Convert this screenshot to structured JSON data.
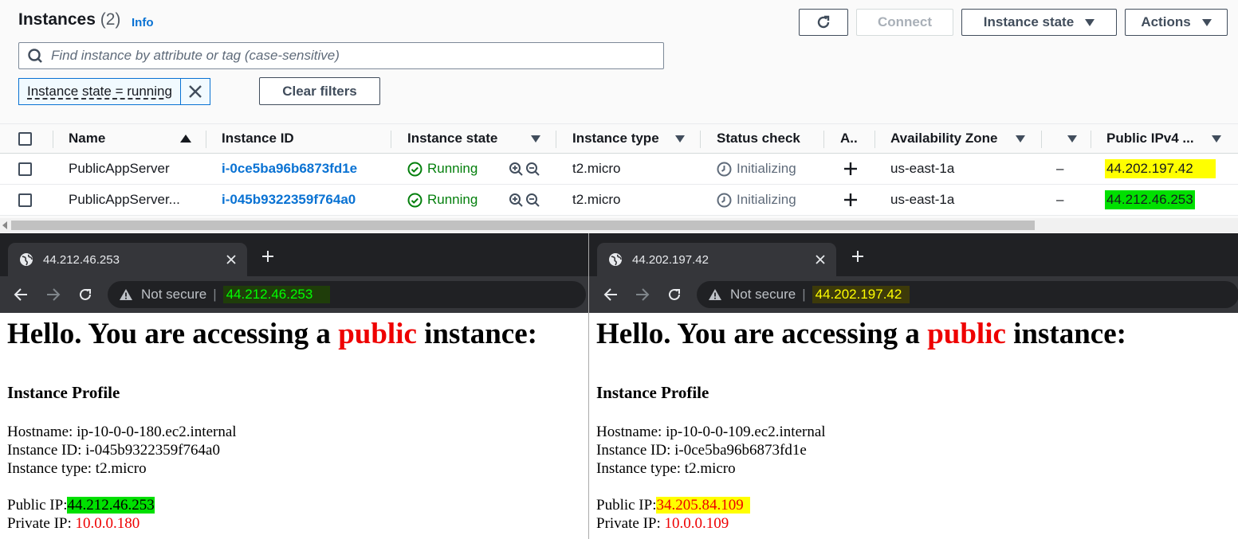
{
  "console": {
    "title": "Instances",
    "count": "(2)",
    "info": "Info",
    "buttons": {
      "connect": "Connect",
      "instance_state": "Instance state",
      "actions": "Actions"
    },
    "search_placeholder": "Find instance by attribute or tag (case-sensitive)",
    "filter_token": "Instance state = running",
    "clear_filters": "Clear filters",
    "columns": [
      "Name",
      "Instance ID",
      "Instance state",
      "Instance type",
      "Status check",
      "A..",
      "Availability Zone",
      "Public IPv4 ..."
    ],
    "rows": [
      {
        "name": "PublicAppServer",
        "id": "i-0ce5ba96b6873fd1e",
        "state": "Running",
        "type": "t2.micro",
        "status": "Initializing",
        "zone": "us-east-1a",
        "dash": "–",
        "ip": "44.202.197.42"
      },
      {
        "name": "PublicAppServer...",
        "id": "i-045b9322359f764a0",
        "state": "Running",
        "type": "t2.micro",
        "status": "Initializing",
        "zone": "us-east-1a",
        "dash": "–",
        "ip": "44.212.46.253"
      }
    ]
  },
  "browser_left": {
    "tab_title": "44.212.46.253",
    "not_secure": "Not secure",
    "url": "44.212.46.253",
    "heading_pre": "Hello. You are accessing a ",
    "heading_public": "public",
    "heading_post": " instance:",
    "profile": "Instance Profile",
    "hostname": "Hostname: ip-10-0-0-180.ec2.internal",
    "instance_id": "Instance ID: i-045b9322359f764a0",
    "instance_type": "Instance type: t2.micro",
    "public_ip_label": "Public IP:",
    "public_ip": "44.212.46.253",
    "private_ip_label": "Private IP:",
    "private_ip": "10.0.0.180"
  },
  "browser_right": {
    "tab_title": "44.202.197.42",
    "not_secure": "Not secure",
    "url": "44.202.197.42",
    "heading_pre": "Hello. You are accessing a ",
    "heading_public": "public",
    "heading_post": " instance:",
    "profile": "Instance Profile",
    "hostname": "Hostname: ip-10-0-0-109.ec2.internal",
    "instance_id": "Instance ID: i-0ce5ba96b6873fd1e",
    "instance_type": "Instance type: t2.micro",
    "public_ip_label": "Public IP:",
    "public_ip": "34.205.84.109",
    "private_ip_label": "Private IP:",
    "private_ip": "10.0.0.109"
  },
  "colors": {
    "aws_link": "#0972d3",
    "running": "#037f0c",
    "highlight_yellow": "#ffff00",
    "highlight_green": "#00e000",
    "public_red": "#ee0000"
  }
}
